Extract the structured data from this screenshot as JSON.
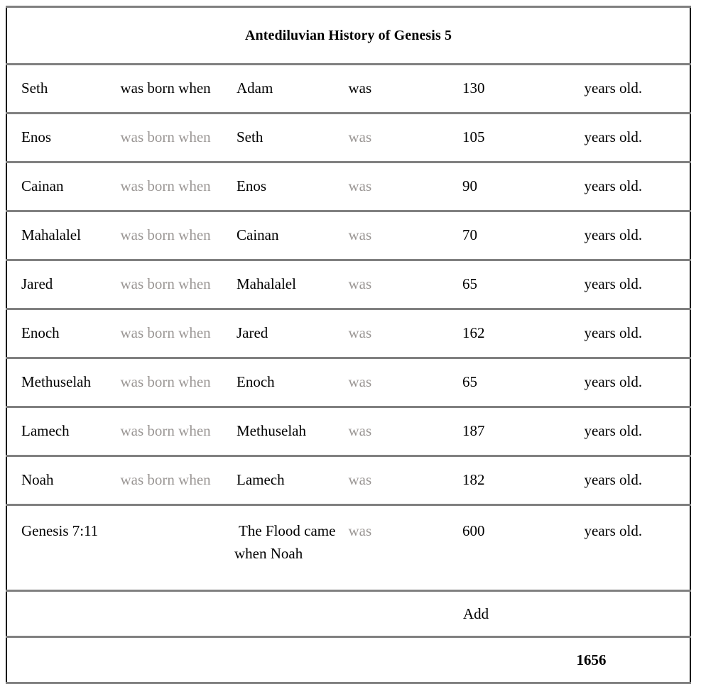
{
  "table": {
    "title": "Antediluvian History of Genesis 5",
    "phrase_born": "was born when",
    "phrase_was": "was",
    "phrase_suffix": "years old.",
    "rows": [
      {
        "subject": "Seth",
        "phrase": "was born when",
        "object": "Adam",
        "was": "was",
        "age": "130",
        "suffix": "years old.",
        "muted": false
      },
      {
        "subject": "Enos",
        "phrase": "was born when",
        "object": "Seth",
        "was": "was",
        "age": "105",
        "suffix": "years old.",
        "muted": true
      },
      {
        "subject": "Cainan",
        "phrase": "was born when",
        "object": "Enos",
        "was": "was",
        "age": "90",
        "suffix": "years old.",
        "muted": true
      },
      {
        "subject": "Mahalalel",
        "phrase": "was born when",
        "object": "Cainan",
        "was": "was",
        "age": "70",
        "suffix": "years old.",
        "muted": true
      },
      {
        "subject": "Jared",
        "phrase": "was born when",
        "object": "Mahalalel",
        "was": "was",
        "age": "65",
        "suffix": "years old.",
        "muted": true
      },
      {
        "subject": "Enoch",
        "phrase": "was born when",
        "object": "Jared",
        "was": "was",
        "age": "162",
        "suffix": "years old.",
        "muted": true
      },
      {
        "subject": "Methuselah",
        "phrase": "was born when",
        "object": "Enoch",
        "was": "was",
        "age": "65",
        "suffix": "years old.",
        "muted": true
      },
      {
        "subject": "Lamech",
        "phrase": "was born when",
        "object": "Methuselah",
        "was": "was",
        "age": "187",
        "suffix": "years old.",
        "muted": true
      },
      {
        "subject": "Noah",
        "phrase": "was born when",
        "object": "Lamech",
        "was": "was",
        "age": "182",
        "suffix": "years old.",
        "muted": true
      }
    ],
    "flood_row": {
      "reference": "Genesis 7:11",
      "statement": "The Flood came when Noah",
      "was": "was",
      "age": "600",
      "suffix": "years old."
    },
    "add_row": {
      "label": "Add"
    },
    "total_row": {
      "total": "1656"
    }
  },
  "colors": {
    "text": "#000000",
    "muted_text": "#9a9694",
    "rule": "#808080",
    "side_border": "#1a1a1a",
    "background": "#ffffff"
  }
}
